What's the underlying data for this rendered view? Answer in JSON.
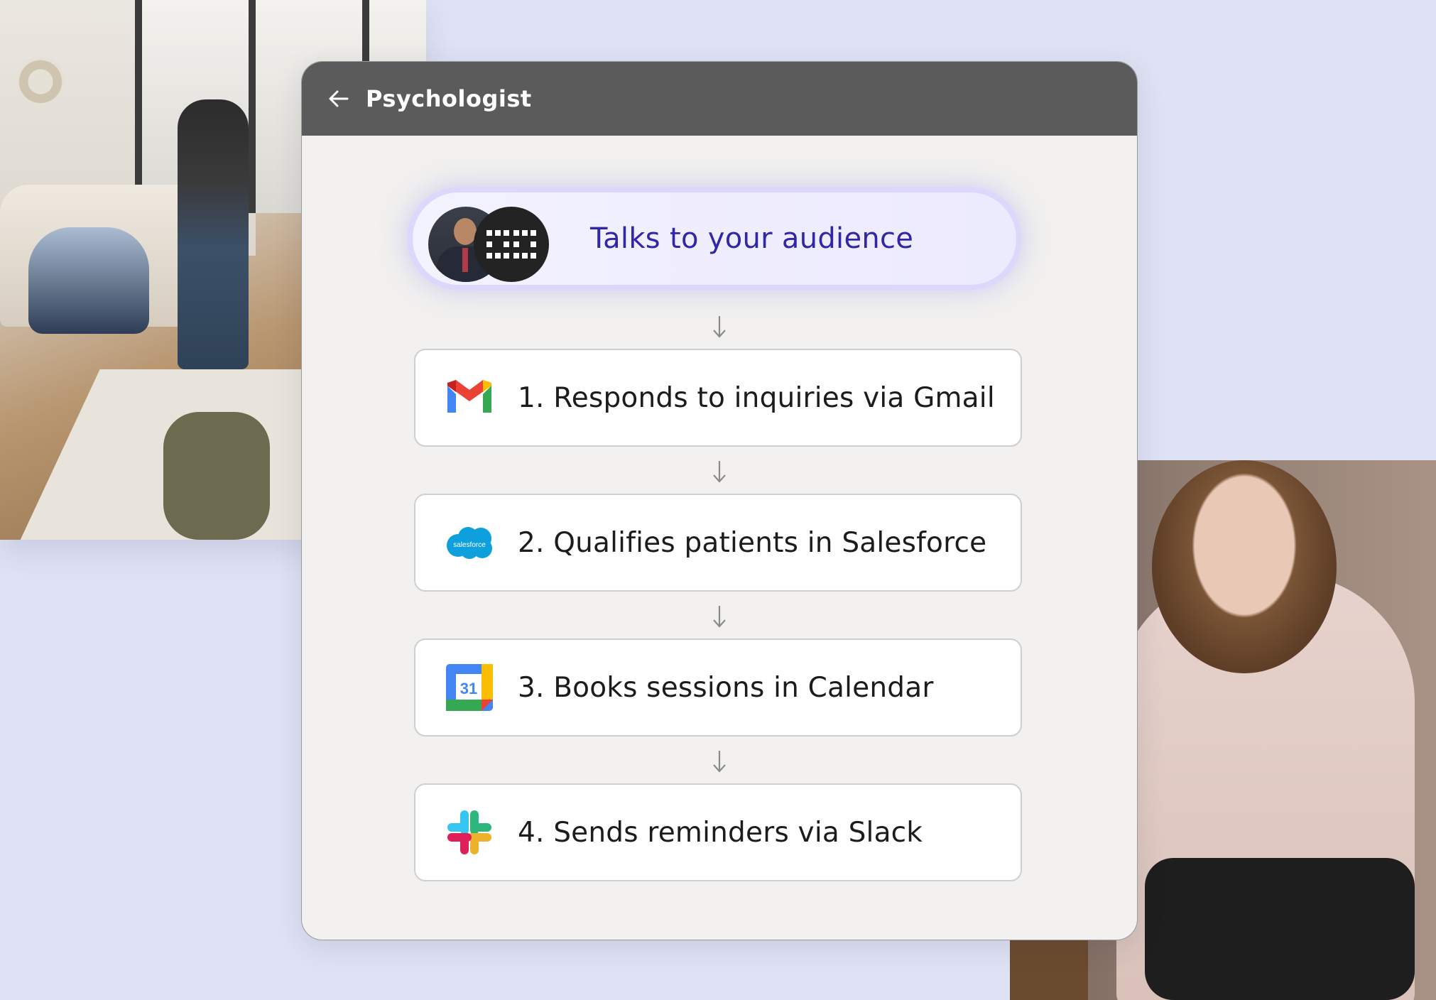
{
  "header": {
    "title": "Psychologist"
  },
  "agent": {
    "text": "Talks to your audience"
  },
  "steps": [
    {
      "label": "1. Responds to inquiries via Gmail",
      "icon": "gmail-icon"
    },
    {
      "label": "2. Qualifies patients in Salesforce",
      "icon": "salesforce-icon"
    },
    {
      "label": "3. Books sessions in Calendar",
      "icon": "google-calendar-icon"
    },
    {
      "label": "4. Sends reminders via Slack",
      "icon": "slack-icon"
    }
  ],
  "icons": {
    "salesforce_text": "salesforce",
    "calendar_day": "31"
  },
  "colors": {
    "background": "#dfe2f4",
    "header": "#5b5b5b",
    "agent_text": "#2f27a8",
    "card": "#f2f1ef"
  }
}
